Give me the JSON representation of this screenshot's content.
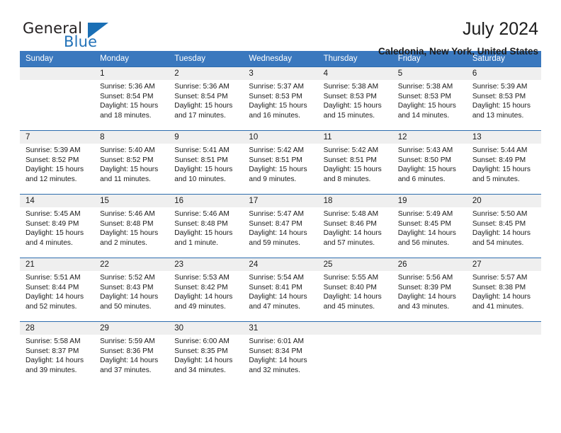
{
  "brand": {
    "name_part1": "General",
    "name_part2": "Blue",
    "accent_color": "#2272b8",
    "triangle_icon": "triangle-icon"
  },
  "header": {
    "title": "July 2024",
    "subtitle": "Caledonia, New York, United States"
  },
  "calendar": {
    "header_bg": "#3a78be",
    "daynum_bg": "#efefef",
    "weekday_headers": [
      "Sunday",
      "Monday",
      "Tuesday",
      "Wednesday",
      "Thursday",
      "Friday",
      "Saturday"
    ],
    "weeks": [
      [
        {
          "day": "",
          "empty": true,
          "sunrise": "",
          "sunset": "",
          "daylight1": "",
          "daylight2": ""
        },
        {
          "day": "1",
          "sunrise": "Sunrise: 5:36 AM",
          "sunset": "Sunset: 8:54 PM",
          "daylight1": "Daylight: 15 hours",
          "daylight2": "and 18 minutes."
        },
        {
          "day": "2",
          "sunrise": "Sunrise: 5:36 AM",
          "sunset": "Sunset: 8:54 PM",
          "daylight1": "Daylight: 15 hours",
          "daylight2": "and 17 minutes."
        },
        {
          "day": "3",
          "sunrise": "Sunrise: 5:37 AM",
          "sunset": "Sunset: 8:53 PM",
          "daylight1": "Daylight: 15 hours",
          "daylight2": "and 16 minutes."
        },
        {
          "day": "4",
          "sunrise": "Sunrise: 5:38 AM",
          "sunset": "Sunset: 8:53 PM",
          "daylight1": "Daylight: 15 hours",
          "daylight2": "and 15 minutes."
        },
        {
          "day": "5",
          "sunrise": "Sunrise: 5:38 AM",
          "sunset": "Sunset: 8:53 PM",
          "daylight1": "Daylight: 15 hours",
          "daylight2": "and 14 minutes."
        },
        {
          "day": "6",
          "sunrise": "Sunrise: 5:39 AM",
          "sunset": "Sunset: 8:53 PM",
          "daylight1": "Daylight: 15 hours",
          "daylight2": "and 13 minutes."
        }
      ],
      [
        {
          "day": "7",
          "sunrise": "Sunrise: 5:39 AM",
          "sunset": "Sunset: 8:52 PM",
          "daylight1": "Daylight: 15 hours",
          "daylight2": "and 12 minutes."
        },
        {
          "day": "8",
          "sunrise": "Sunrise: 5:40 AM",
          "sunset": "Sunset: 8:52 PM",
          "daylight1": "Daylight: 15 hours",
          "daylight2": "and 11 minutes."
        },
        {
          "day": "9",
          "sunrise": "Sunrise: 5:41 AM",
          "sunset": "Sunset: 8:51 PM",
          "daylight1": "Daylight: 15 hours",
          "daylight2": "and 10 minutes."
        },
        {
          "day": "10",
          "sunrise": "Sunrise: 5:42 AM",
          "sunset": "Sunset: 8:51 PM",
          "daylight1": "Daylight: 15 hours",
          "daylight2": "and 9 minutes."
        },
        {
          "day": "11",
          "sunrise": "Sunrise: 5:42 AM",
          "sunset": "Sunset: 8:51 PM",
          "daylight1": "Daylight: 15 hours",
          "daylight2": "and 8 minutes."
        },
        {
          "day": "12",
          "sunrise": "Sunrise: 5:43 AM",
          "sunset": "Sunset: 8:50 PM",
          "daylight1": "Daylight: 15 hours",
          "daylight2": "and 6 minutes."
        },
        {
          "day": "13",
          "sunrise": "Sunrise: 5:44 AM",
          "sunset": "Sunset: 8:49 PM",
          "daylight1": "Daylight: 15 hours",
          "daylight2": "and 5 minutes."
        }
      ],
      [
        {
          "day": "14",
          "sunrise": "Sunrise: 5:45 AM",
          "sunset": "Sunset: 8:49 PM",
          "daylight1": "Daylight: 15 hours",
          "daylight2": "and 4 minutes."
        },
        {
          "day": "15",
          "sunrise": "Sunrise: 5:46 AM",
          "sunset": "Sunset: 8:48 PM",
          "daylight1": "Daylight: 15 hours",
          "daylight2": "and 2 minutes."
        },
        {
          "day": "16",
          "sunrise": "Sunrise: 5:46 AM",
          "sunset": "Sunset: 8:48 PM",
          "daylight1": "Daylight: 15 hours",
          "daylight2": "and 1 minute."
        },
        {
          "day": "17",
          "sunrise": "Sunrise: 5:47 AM",
          "sunset": "Sunset: 8:47 PM",
          "daylight1": "Daylight: 14 hours",
          "daylight2": "and 59 minutes."
        },
        {
          "day": "18",
          "sunrise": "Sunrise: 5:48 AM",
          "sunset": "Sunset: 8:46 PM",
          "daylight1": "Daylight: 14 hours",
          "daylight2": "and 57 minutes."
        },
        {
          "day": "19",
          "sunrise": "Sunrise: 5:49 AM",
          "sunset": "Sunset: 8:45 PM",
          "daylight1": "Daylight: 14 hours",
          "daylight2": "and 56 minutes."
        },
        {
          "day": "20",
          "sunrise": "Sunrise: 5:50 AM",
          "sunset": "Sunset: 8:45 PM",
          "daylight1": "Daylight: 14 hours",
          "daylight2": "and 54 minutes."
        }
      ],
      [
        {
          "day": "21",
          "sunrise": "Sunrise: 5:51 AM",
          "sunset": "Sunset: 8:44 PM",
          "daylight1": "Daylight: 14 hours",
          "daylight2": "and 52 minutes."
        },
        {
          "day": "22",
          "sunrise": "Sunrise: 5:52 AM",
          "sunset": "Sunset: 8:43 PM",
          "daylight1": "Daylight: 14 hours",
          "daylight2": "and 50 minutes."
        },
        {
          "day": "23",
          "sunrise": "Sunrise: 5:53 AM",
          "sunset": "Sunset: 8:42 PM",
          "daylight1": "Daylight: 14 hours",
          "daylight2": "and 49 minutes."
        },
        {
          "day": "24",
          "sunrise": "Sunrise: 5:54 AM",
          "sunset": "Sunset: 8:41 PM",
          "daylight1": "Daylight: 14 hours",
          "daylight2": "and 47 minutes."
        },
        {
          "day": "25",
          "sunrise": "Sunrise: 5:55 AM",
          "sunset": "Sunset: 8:40 PM",
          "daylight1": "Daylight: 14 hours",
          "daylight2": "and 45 minutes."
        },
        {
          "day": "26",
          "sunrise": "Sunrise: 5:56 AM",
          "sunset": "Sunset: 8:39 PM",
          "daylight1": "Daylight: 14 hours",
          "daylight2": "and 43 minutes."
        },
        {
          "day": "27",
          "sunrise": "Sunrise: 5:57 AM",
          "sunset": "Sunset: 8:38 PM",
          "daylight1": "Daylight: 14 hours",
          "daylight2": "and 41 minutes."
        }
      ],
      [
        {
          "day": "28",
          "sunrise": "Sunrise: 5:58 AM",
          "sunset": "Sunset: 8:37 PM",
          "daylight1": "Daylight: 14 hours",
          "daylight2": "and 39 minutes."
        },
        {
          "day": "29",
          "sunrise": "Sunrise: 5:59 AM",
          "sunset": "Sunset: 8:36 PM",
          "daylight1": "Daylight: 14 hours",
          "daylight2": "and 37 minutes."
        },
        {
          "day": "30",
          "sunrise": "Sunrise: 6:00 AM",
          "sunset": "Sunset: 8:35 PM",
          "daylight1": "Daylight: 14 hours",
          "daylight2": "and 34 minutes."
        },
        {
          "day": "31",
          "sunrise": "Sunrise: 6:01 AM",
          "sunset": "Sunset: 8:34 PM",
          "daylight1": "Daylight: 14 hours",
          "daylight2": "and 32 minutes."
        },
        {
          "day": "",
          "empty": true,
          "sunrise": "",
          "sunset": "",
          "daylight1": "",
          "daylight2": ""
        },
        {
          "day": "",
          "empty": true,
          "sunrise": "",
          "sunset": "",
          "daylight1": "",
          "daylight2": ""
        },
        {
          "day": "",
          "empty": true,
          "sunrise": "",
          "sunset": "",
          "daylight1": "",
          "daylight2": ""
        }
      ]
    ]
  }
}
